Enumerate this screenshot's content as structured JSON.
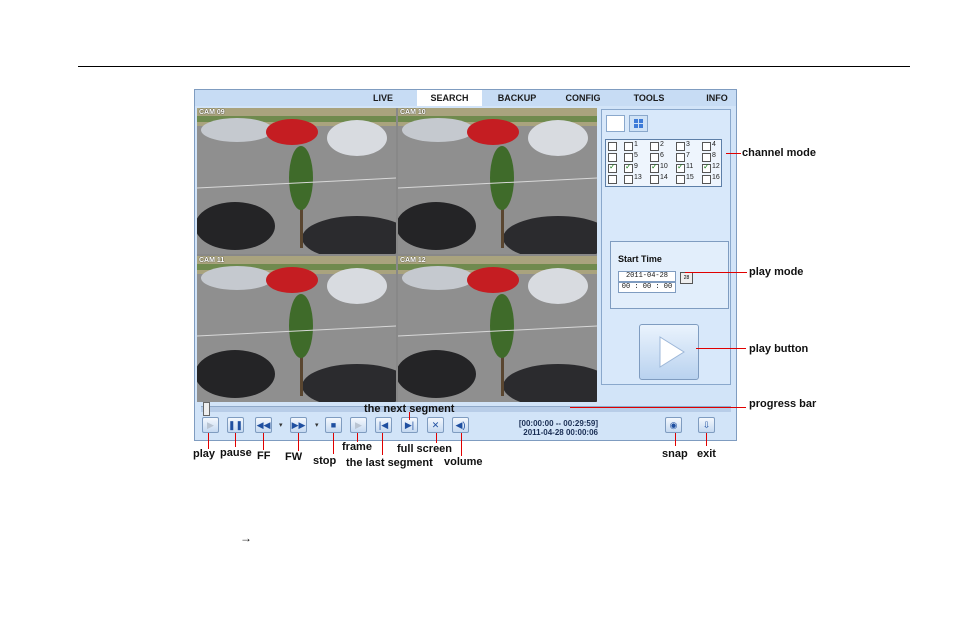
{
  "tabs": [
    "LIVE",
    "SEARCH",
    "BACKUP",
    "CONFIG",
    "TOOLS",
    "INFO"
  ],
  "active_tab": "SEARCH",
  "cameras": [
    {
      "label": "CAM 09"
    },
    {
      "label": "CAM 10"
    },
    {
      "label": "CAM 11"
    },
    {
      "label": "CAM 12"
    }
  ],
  "channels": [
    [
      {
        "n": "1",
        "checked": false
      },
      {
        "n": "2",
        "checked": false
      },
      {
        "n": "3",
        "checked": false
      },
      {
        "n": "4",
        "checked": false
      }
    ],
    [
      {
        "n": "5",
        "checked": false
      },
      {
        "n": "6",
        "checked": false
      },
      {
        "n": "7",
        "checked": false
      },
      {
        "n": "8",
        "checked": false
      }
    ],
    [
      {
        "n": "9",
        "checked": true
      },
      {
        "n": "10",
        "checked": true
      },
      {
        "n": "11",
        "checked": true
      },
      {
        "n": "12",
        "checked": true
      }
    ],
    [
      {
        "n": "13",
        "checked": false
      },
      {
        "n": "14",
        "checked": false
      },
      {
        "n": "15",
        "checked": false
      },
      {
        "n": "16",
        "checked": false
      }
    ]
  ],
  "start_time": {
    "title": "Start Time",
    "date": "2011-04-28",
    "time": "00 : 00 : 00"
  },
  "time_info": {
    "range": "[00:00:00 -- 00:29:59]",
    "current": "2011-04-28 00:00:06"
  },
  "annotations": {
    "channel_mode": "channel mode",
    "play_mode": "play mode",
    "play_button": "play button",
    "progress_bar": "progress bar",
    "next_segment": "the next segment",
    "play": "play",
    "pause": "pause",
    "ff": "FF",
    "fw": "FW",
    "stop": "stop",
    "frame": "frame",
    "last_segment": "the last segment",
    "full_screen": "full screen",
    "volume": "volume",
    "snap": "snap",
    "exit": "exit"
  },
  "arrow_symbol": "→",
  "colors": {
    "callout_line": "#e00000",
    "panel_bg": "#d2e4f8",
    "accent": "#1f4fa0"
  }
}
